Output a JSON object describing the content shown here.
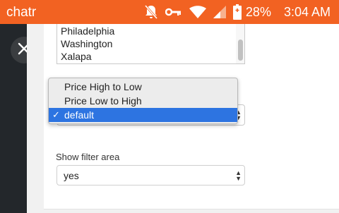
{
  "status_bar": {
    "carrier": "chatr",
    "battery": "28%",
    "time": "3:04 AM",
    "color": "#f26222"
  },
  "icons": [
    "notifications-off-icon",
    "vpn-key-icon",
    "wifi-icon",
    "signal-icon",
    "battery-charging-icon",
    "close-icon",
    "select-arrows-icon"
  ],
  "cities": [
    "Philadelphia",
    "Washington",
    "Xalapa"
  ],
  "sort": {
    "options": [
      "Price High to Low",
      "Price Low to High",
      "default"
    ],
    "selected": "default",
    "check": "✓"
  },
  "filter": {
    "label": "Show filter area",
    "value": "yes"
  },
  "colors": {
    "accent": "#2d74e1",
    "side_strip": "#23272b"
  }
}
